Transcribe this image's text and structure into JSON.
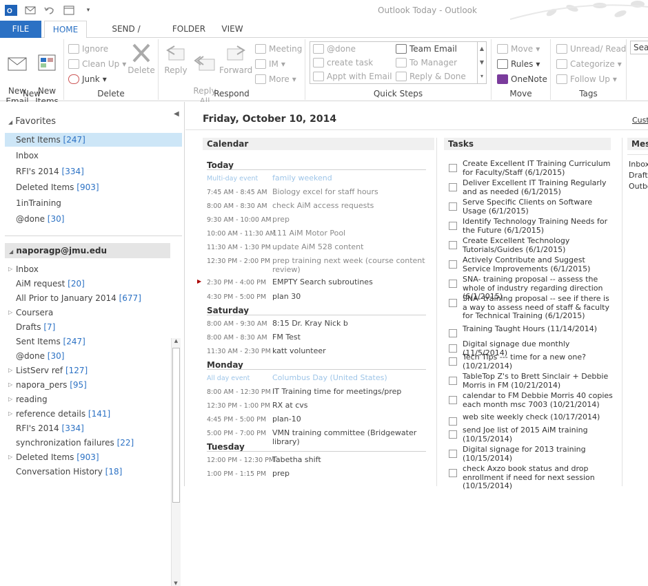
{
  "window": {
    "title": "Outlook Today - Outlook"
  },
  "tabs": [
    {
      "label": "FILE"
    },
    {
      "label": "HOME"
    },
    {
      "label": "SEND / RECEIVE"
    },
    {
      "label": "FOLDER"
    },
    {
      "label": "VIEW"
    }
  ],
  "ribbon": {
    "new": {
      "new_email": "New\nEmail",
      "new_items": "New\nItems",
      "label": "New"
    },
    "delete": {
      "ignore": "Ignore",
      "cleanup": "Clean Up",
      "junk": "Junk",
      "delete": "Delete",
      "label": "Delete"
    },
    "respond": {
      "reply": "Reply",
      "reply_all": "Reply\nAll",
      "forward": "Forward",
      "meeting": "Meeting",
      "im": "IM",
      "more": "More",
      "label": "Respond"
    },
    "quick_steps": {
      "items": [
        "@done",
        "create task",
        "Appt with Email",
        "Team Email",
        "To Manager",
        "Reply & Done"
      ],
      "label": "Quick Steps"
    },
    "move": {
      "move": "Move",
      "rules": "Rules",
      "onenote": "OneNote",
      "label": "Move"
    },
    "tags": {
      "unread": "Unread/ Read",
      "categorize": "Categorize",
      "follow": "Follow Up",
      "label": "Tags"
    },
    "find": {
      "search": "Sear"
    }
  },
  "favorites": {
    "header": "Favorites",
    "items": [
      {
        "label": "Sent Items",
        "count": "[247]"
      },
      {
        "label": "Inbox",
        "count": ""
      },
      {
        "label": "RFI's 2014",
        "count": "[334]"
      },
      {
        "label": "Deleted Items",
        "count": "[903]"
      },
      {
        "label": "1inTraining",
        "count": ""
      },
      {
        "label": "@done",
        "count": "[30]"
      }
    ]
  },
  "account": {
    "header": "naporagp@jmu.edu",
    "items": [
      {
        "label": "Inbox",
        "count": "",
        "exp": true
      },
      {
        "label": "AiM request",
        "count": "[20]",
        "exp": false
      },
      {
        "label": "All Prior to January 2014",
        "count": "[677]",
        "exp": false
      },
      {
        "label": "Coursera",
        "count": "",
        "exp": true
      },
      {
        "label": "Drafts",
        "count": "[7]",
        "exp": false
      },
      {
        "label": "Sent Items",
        "count": "[247]",
        "exp": false
      },
      {
        "label": "@done",
        "count": "[30]",
        "exp": false
      },
      {
        "label": "ListServ ref",
        "count": "[127]",
        "exp": true
      },
      {
        "label": "napora_pers",
        "count": "[95]",
        "exp": true
      },
      {
        "label": "reading",
        "count": "",
        "exp": true
      },
      {
        "label": "reference details",
        "count": "[141]",
        "exp": true
      },
      {
        "label": "RFI's 2014",
        "count": "[334]",
        "exp": false
      },
      {
        "label": "synchronization failures",
        "count": "[22]",
        "exp": false
      },
      {
        "label": "Deleted Items",
        "count": "[903]",
        "exp": true
      },
      {
        "label": "Conversation History",
        "count": "[18]",
        "exp": false
      }
    ]
  },
  "today": {
    "date": "Friday, October 10, 2014",
    "customize": "Cust"
  },
  "calendar": {
    "header": "Calendar",
    "days": [
      {
        "name": "Today",
        "events": [
          {
            "time": "Multi-day event",
            "subject": "family weekend",
            "style": "light"
          },
          {
            "time": "7:45 AM - 8:45 AM",
            "subject": "Biology excel for staff hours",
            "style": "past"
          },
          {
            "time": "8:00 AM - 8:30 AM",
            "subject": "check AiM access requests",
            "style": "past"
          },
          {
            "time": "9:30 AM - 10:00 AM",
            "subject": "prep",
            "style": "past"
          },
          {
            "time": "10:00 AM - 11:30 AM",
            "subject": "111 AiM Motor Pool",
            "style": "past"
          },
          {
            "time": "11:30 AM - 1:30 PM",
            "subject": "update AiM 528 content",
            "style": "past"
          },
          {
            "time": "12:30 PM - 2:00 PM",
            "subject": "prep training next week (course content review)",
            "style": "past"
          },
          {
            "time": "2:30 PM - 4:00 PM",
            "subject": "EMPTY Search subroutines",
            "style": "cur"
          },
          {
            "time": "4:30 PM - 5:00 PM",
            "subject": "plan 30",
            "style": "cur"
          }
        ]
      },
      {
        "name": "Saturday",
        "events": [
          {
            "time": "8:00 AM - 9:30 AM",
            "subject": "8:15 Dr. Kray Nick b",
            "style": "cur"
          },
          {
            "time": "8:00 AM - 8:30 AM",
            "subject": "FM Test",
            "style": "cur"
          },
          {
            "time": "11:30 AM - 2:30 PM",
            "subject": "katt volunteer",
            "style": "cur"
          }
        ]
      },
      {
        "name": "Monday",
        "events": [
          {
            "time": "All day event",
            "subject": "Columbus Day (United States)",
            "style": "light"
          },
          {
            "time": "8:00 AM - 12:30 PM",
            "subject": "IT Training time for meetings/prep",
            "style": "cur"
          },
          {
            "time": "12:30 PM - 1:00 PM",
            "subject": "RX at cvs",
            "style": "cur"
          },
          {
            "time": "4:45 PM - 5:00 PM",
            "subject": "plan-10",
            "style": "cur"
          },
          {
            "time": "5:00 PM - 7:00 PM",
            "subject": "VMN training committee (Bridgewater library)",
            "style": "cur"
          }
        ]
      },
      {
        "name": "Tuesday",
        "events": [
          {
            "time": "12:00 PM - 12:30 PM",
            "subject": "Tabetha shift",
            "style": "cur"
          },
          {
            "time": "1:00 PM - 1:15 PM",
            "subject": "prep",
            "style": "cur"
          }
        ]
      }
    ]
  },
  "tasks": {
    "header": "Tasks",
    "items": [
      "Create Excellent IT Training Curriculum for Faculty/Staff (6/1/2015)",
      "Deliver Excellent IT Training Regularly and as needed (6/1/2015)",
      "Serve Specific Clients on Software Usage (6/1/2015)",
      "Identify Technology Training Needs for the Future (6/1/2015)",
      "Create Excellent Technology Tutorials/Guides (6/1/2015)",
      "Actively Contribute and Suggest Service Improvements (6/1/2015)",
      "SNA- training proposal -- assess the whole of industry regarding direction (6/1/2015)",
      "SNA- training proposal -- see if there is a way to assess need of staff & faculty for Technical Training (6/1/2015)",
      "Training Taught Hours (11/14/2014)",
      "Digital signage due monthly (11/5/2014)",
      "Tech Tips --- time for a new one? (10/21/2014)",
      "TableTop Z's to Brett Sinclair + Debbie Morris in FM (10/21/2014)",
      "calendar to FM Debbie Morris 40 copies each month msc 7003 (10/21/2014)",
      "web site weekly check (10/17/2014)",
      "send Joe list of 2015 AiM training (10/15/2014)",
      "Digital signage for 2013 training (10/15/2014)",
      "check Axzo book status and drop enrollment if need for next session (10/15/2014)"
    ]
  },
  "messages": {
    "header": "Mes",
    "items": [
      "Inbox",
      "Drafts",
      "Outbo"
    ]
  },
  "colors": {
    "accent": "#2b71c4",
    "selected": "#cde6f7"
  }
}
